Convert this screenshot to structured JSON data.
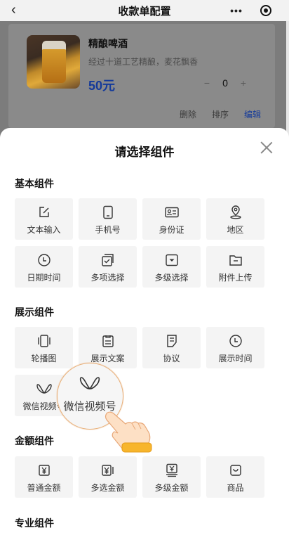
{
  "navbar": {
    "title": "收款单配置",
    "more_icon": "more-dots-icon",
    "close_icon": "target-icon"
  },
  "product": {
    "name": "精酿啤酒",
    "description": "经过十道工艺精酿，麦花飘香",
    "price": "50元",
    "quantity": "0",
    "actions": {
      "delete": "删除",
      "sort": "排序",
      "edit": "编辑"
    }
  },
  "sheet": {
    "title": "请选择组件",
    "sections": [
      {
        "title": "基本组件",
        "items": [
          {
            "label": "文本输入",
            "icon": "edit-icon"
          },
          {
            "label": "手机号",
            "icon": "phone-icon"
          },
          {
            "label": "身份证",
            "icon": "id-card-icon"
          },
          {
            "label": "地区",
            "icon": "location-icon"
          },
          {
            "label": "日期时间",
            "icon": "clock-icon"
          },
          {
            "label": "多项选择",
            "icon": "multi-check-icon"
          },
          {
            "label": "多级选择",
            "icon": "dropdown-icon"
          },
          {
            "label": "附件上传",
            "icon": "folder-icon"
          }
        ]
      },
      {
        "title": "展示组件",
        "items": [
          {
            "label": "轮播图",
            "icon": "carousel-icon"
          },
          {
            "label": "展示文案",
            "icon": "text-doc-icon"
          },
          {
            "label": "协议",
            "icon": "agreement-icon"
          },
          {
            "label": "展示时间",
            "icon": "clock-icon"
          },
          {
            "label": "微信视频号",
            "icon": "channels-icon"
          }
        ]
      },
      {
        "title": "金额组件",
        "items": [
          {
            "label": "普通金额",
            "icon": "yuan-icon"
          },
          {
            "label": "多选金额",
            "icon": "multi-yuan-icon"
          },
          {
            "label": "多级金额",
            "icon": "tiered-yuan-icon"
          },
          {
            "label": "商品",
            "icon": "shopping-bag-icon"
          }
        ]
      },
      {
        "title": "专业组件"
      }
    ],
    "magnifier_label": "微信视频号"
  },
  "colors": {
    "accent_blue": "#143a9a",
    "overlay_gray": "#7c7c7c",
    "highlight_ring": "#e8b07a"
  }
}
